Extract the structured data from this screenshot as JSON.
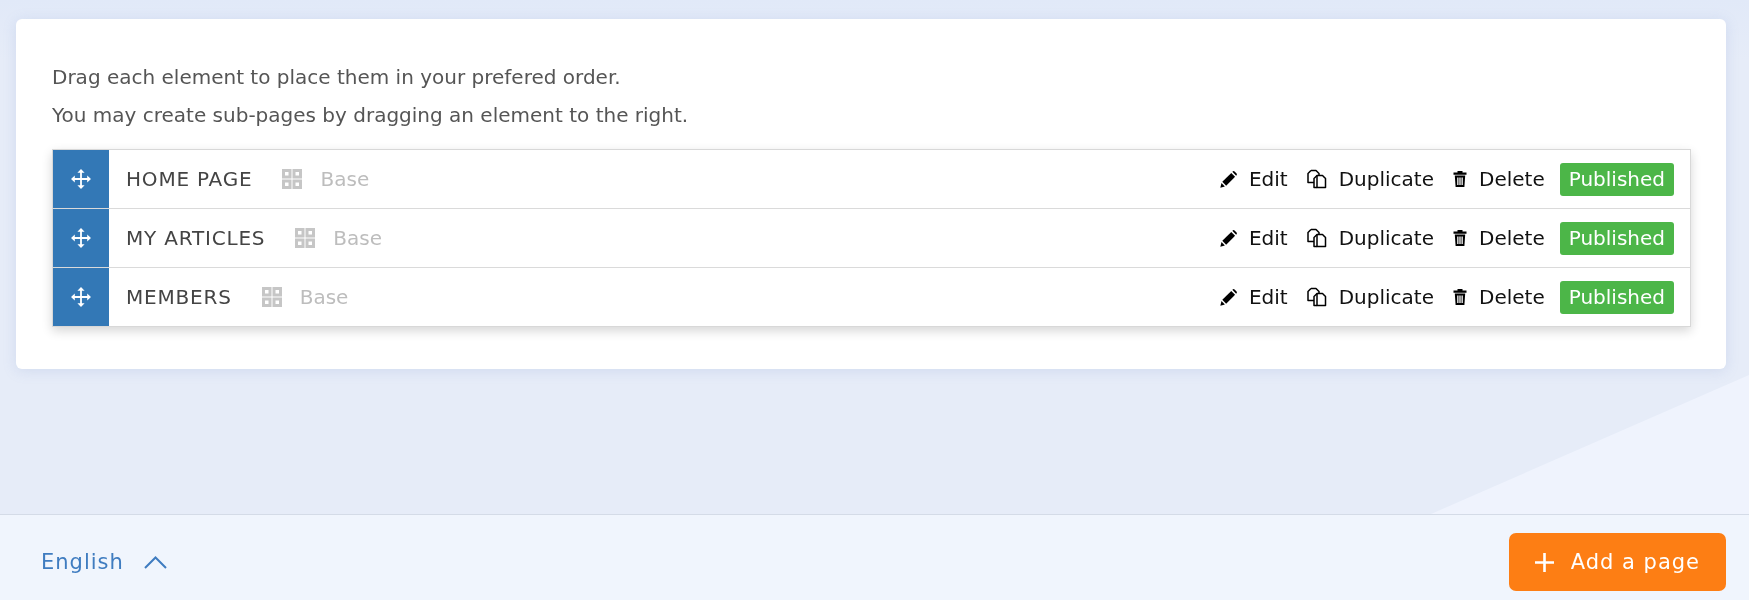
{
  "instructions": [
    "Drag each element to place them in your prefered order.",
    "You may create sub-pages by dragging an element to the right."
  ],
  "pages": [
    {
      "title": "HOME PAGE",
      "template": "Base",
      "actions": [
        {
          "kind": "edit",
          "label": "Edit"
        },
        {
          "kind": "duplicate",
          "label": "Duplicate"
        },
        {
          "kind": "delete",
          "label": "Delete"
        }
      ],
      "status": "Published"
    },
    {
      "title": "MY ARTICLES",
      "template": "Base",
      "actions": [
        {
          "kind": "edit",
          "label": "Edit"
        },
        {
          "kind": "duplicate",
          "label": "Duplicate"
        },
        {
          "kind": "delete",
          "label": "Delete"
        }
      ],
      "status": "Published"
    },
    {
      "title": "MEMBERS",
      "template": "Base",
      "actions": [
        {
          "kind": "edit",
          "label": "Edit"
        },
        {
          "kind": "duplicate",
          "label": "Duplicate"
        },
        {
          "kind": "delete",
          "label": "Delete"
        }
      ],
      "status": "Published"
    }
  ],
  "footer": {
    "language": "English",
    "add_button": "Add a page"
  }
}
